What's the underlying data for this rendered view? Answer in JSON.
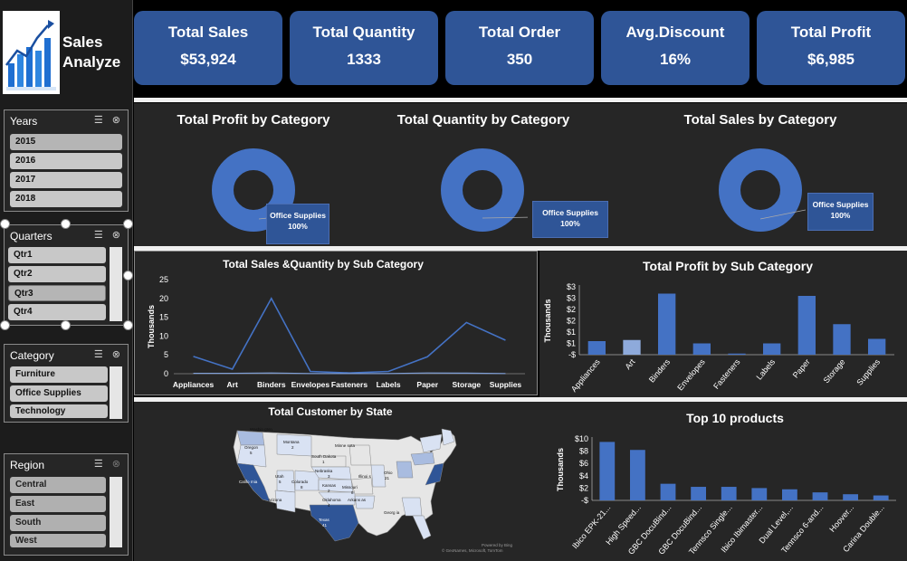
{
  "app": {
    "title_line1": "Sales",
    "title_line2": "Analyze"
  },
  "kpis": [
    {
      "label": "Total Sales",
      "value": "$53,924"
    },
    {
      "label": "Total Quantity",
      "value": "1333"
    },
    {
      "label": "Total Order",
      "value": "350"
    },
    {
      "label": "Avg.Discount",
      "value": "16%"
    },
    {
      "label": "Total Profit",
      "value": "$6,985"
    }
  ],
  "slicers": {
    "years": {
      "title": "Years",
      "items": [
        "2015",
        "2016",
        "2017",
        "2018"
      ]
    },
    "quarters": {
      "title": "Quarters",
      "items": [
        "Qtr1",
        "Qtr2",
        "Qtr3",
        "Qtr4"
      ]
    },
    "category": {
      "title": "Category",
      "items": [
        "Furniture",
        "Office Supplies",
        "Technology"
      ]
    },
    "region": {
      "title": "Region",
      "items": [
        "Central",
        "East",
        "South",
        "West"
      ]
    }
  },
  "donuts": [
    {
      "title": "Total Profit by Category",
      "label": "Office Supplies",
      "pct": "100%"
    },
    {
      "title": "Total Quantity by Category",
      "label": "Office Supplies",
      "pct": "100%"
    },
    {
      "title": "Total Sales by Category",
      "label": "Office Supplies",
      "pct": "100%"
    }
  ],
  "colors": {
    "accent": "#2f5597",
    "bar": "#4472c4",
    "line": "#4472c4",
    "panel": "#262626"
  },
  "chart_data": [
    {
      "type": "line",
      "title": "Total Sales &Quantity by Sub Category",
      "ylabel": "Thousands",
      "categories": [
        "Appliances",
        "Art",
        "Binders",
        "Envelopes",
        "Fasteners",
        "Labels",
        "Paper",
        "Storage",
        "Supplies"
      ],
      "series": [
        {
          "values": [
            4.6,
            1.2,
            20.0,
            0.6,
            0.2,
            0.6,
            4.5,
            13.6,
            8.9
          ]
        },
        {
          "values": [
            0.1,
            0.1,
            0.2,
            0.05,
            0.05,
            0.05,
            0.2,
            0.15,
            0.05
          ]
        }
      ],
      "yticks": [
        "0",
        "5",
        "10",
        "15",
        "20",
        "25"
      ],
      "ylim": [
        0,
        25
      ]
    },
    {
      "type": "bar",
      "title": "Total Profit by Sub Category",
      "ylabel": "Thousands",
      "categories": [
        "Appliances",
        "Art",
        "Binders",
        "Envelopes",
        "Fasteners",
        "Labels",
        "Paper",
        "Storage",
        "Supplies"
      ],
      "values": [
        0.6,
        0.65,
        2.7,
        0.5,
        0.05,
        0.5,
        2.6,
        1.35,
        0.7
      ],
      "yticks": [
        "-$",
        "$1",
        "$1",
        "$2",
        "$2",
        "$3",
        "$3"
      ],
      "ylim": [
        0,
        3
      ]
    },
    {
      "type": "bar",
      "title": "Top 10 products",
      "ylabel": "Thousands",
      "categories": [
        "Ibico EPK-21...",
        "High Speed...",
        "GBC DocuBind...",
        "GBC DocuBind...",
        "Tennsco Single...",
        "Ibico Ibimaster...",
        "Dual Level,...",
        "Tennsco 6-and...",
        "Hoover...",
        "Carina Double..."
      ],
      "values": [
        9.5,
        8.2,
        2.7,
        2.2,
        2.2,
        2.0,
        1.8,
        1.3,
        1.0,
        0.8
      ],
      "yticks": [
        "-$",
        "$2",
        "$4",
        "$6",
        "$8",
        "$10"
      ],
      "ylim": [
        0,
        10
      ]
    }
  ],
  "map": {
    "title": "Total Customer by State",
    "labels": [
      {
        "name": "Washin gton",
        "value": ""
      },
      {
        "name": "Montana",
        "value": "2"
      },
      {
        "name": "Oregon",
        "value": "5"
      },
      {
        "name": "Minne sota",
        "value": ""
      },
      {
        "name": "South Dakota",
        "value": "1"
      },
      {
        "name": "Utah",
        "value": "5"
      },
      {
        "name": "Nebraska",
        "value": "3"
      },
      {
        "name": "Illinoi s",
        "value": ""
      },
      {
        "name": "Ohio",
        "value": "21"
      },
      {
        "name": "Colorado",
        "value": "8"
      },
      {
        "name": "Kansas",
        "value": "2"
      },
      {
        "name": "Missouri",
        "value": "8"
      },
      {
        "name": "Califo rnia",
        "value": ""
      },
      {
        "name": "Arizona",
        "value": "7"
      },
      {
        "name": "Oklahoma",
        "value": "4"
      },
      {
        "name": "Arkans as",
        "value": ""
      },
      {
        "name": "Georg ia",
        "value": ""
      },
      {
        "name": "Texas",
        "value": "41"
      }
    ],
    "credit1": "Powered by Bing",
    "credit2": "© GeoNames, Microsoft, TomTom"
  }
}
